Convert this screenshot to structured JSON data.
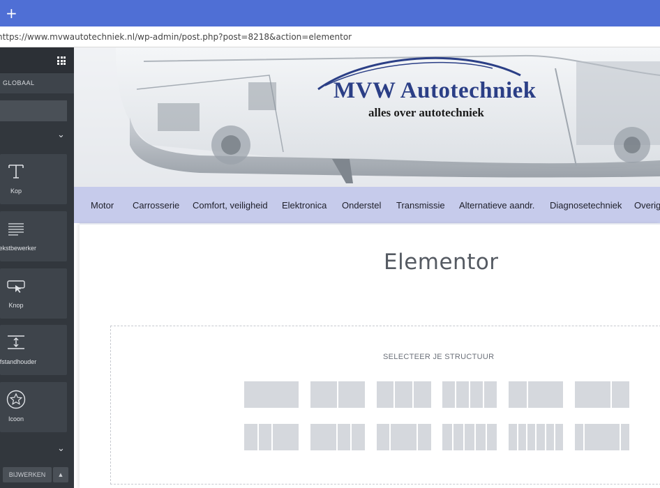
{
  "browser": {
    "new_tab_symbol": "+",
    "url": "https://www.mvwautotechniek.nl/wp-admin/post.php?post=8218&action=elementor"
  },
  "panel": {
    "tab_label": "GLOBAAL",
    "widgets": [
      {
        "label": "Kop",
        "icon": "heading-icon"
      },
      {
        "label": "Tekstbewerker",
        "icon": "text-editor-icon"
      },
      {
        "label": "Knop",
        "icon": "button-icon"
      },
      {
        "label": "Afstandhouder",
        "icon": "spacer-icon"
      },
      {
        "label": "Icoon",
        "icon": "star-icon"
      }
    ],
    "update_button": "BIJWERKEN"
  },
  "site": {
    "logo_title": "MVW Autotechniek",
    "logo_subtitle": "alles over autotechniek",
    "nav": [
      "Motor",
      "Carrosserie",
      "Comfort, veiligheid",
      "Elektronica",
      "Onderstel",
      "Transmissie",
      "Alternatieve aandr.",
      "Diagnosetechniek",
      "Overig"
    ]
  },
  "content": {
    "page_title": "Elementor",
    "structure_label": "SELECTEER JE STRUCTUUR",
    "structures_row1": [
      [
        1
      ],
      [
        1,
        1
      ],
      [
        1,
        1,
        1
      ],
      [
        1,
        1,
        1,
        1
      ],
      [
        1,
        2
      ],
      [
        2,
        1
      ]
    ],
    "structures_row2": [
      [
        1,
        1,
        2
      ],
      [
        2,
        1,
        1
      ],
      [
        1,
        2,
        1
      ],
      [
        1,
        1,
        1,
        1,
        1
      ],
      [
        1,
        1,
        1,
        1,
        1,
        1
      ],
      [
        1,
        4,
        1
      ]
    ]
  },
  "colors": {
    "browser_titlebar": "#4f6fd5",
    "panel": "#32373d",
    "nav_bar": "#c6cbeb",
    "logo_blue": "#2b3f86",
    "preset_block": "#d5d8dd"
  }
}
